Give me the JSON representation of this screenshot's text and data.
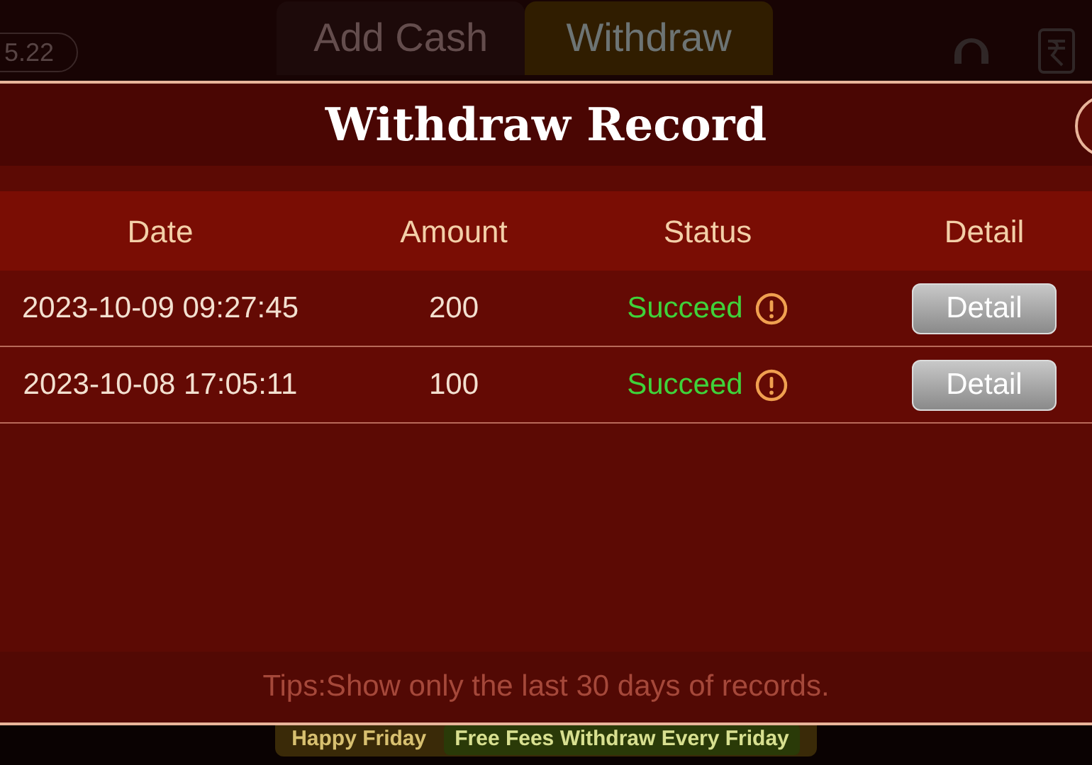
{
  "top_bar": {
    "balance": "5.22",
    "tabs": [
      {
        "label": "Add Cash",
        "selected": false
      },
      {
        "label": "Withdraw",
        "selected": true
      }
    ]
  },
  "dialog": {
    "title": "Withdraw Record",
    "table": {
      "columns": [
        "Date",
        "Amount",
        "Status",
        "Detail"
      ],
      "rows": [
        {
          "date": "2023-10-09 09:27:45",
          "amount": "200",
          "status": "Succeed",
          "color": "#3fd23a",
          "action": "Detail"
        },
        {
          "date": "2023-10-08 17:05:11",
          "amount": "100",
          "status": "Succeed",
          "color": "#3fd23a",
          "action": "Detail"
        }
      ]
    },
    "tips": "Tips:Show only the last 30 days of records."
  },
  "banner": {
    "title": "Happy Friday",
    "subtitle": "Free Fees Withdraw Every Friday"
  }
}
